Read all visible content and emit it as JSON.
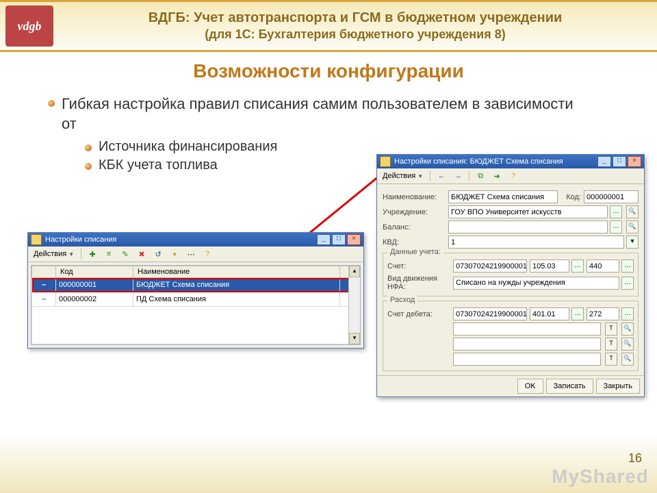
{
  "header": {
    "title1": "ВДГБ: Учет автотранспорта и ГСМ в бюджетном учреждении",
    "title2": "(для 1С: Бухгалтерия бюджетного учреждения 8)"
  },
  "section_title": "Возможности конфигурации",
  "bullets": {
    "main": "Гибкая настройка правил списания самим пользователем в зависимости от",
    "sub1": "Источника финансирования",
    "sub2": "КБК учета топлива"
  },
  "win1": {
    "title": "Настройки списания",
    "actions": "Действия",
    "cols": {
      "code": "Код",
      "name": "Наименование"
    },
    "rows": [
      {
        "code": "000000001",
        "name": "БЮДЖЕТ Схема списания"
      },
      {
        "code": "000000002",
        "name": "ПД Схема списания"
      }
    ]
  },
  "win2": {
    "title": "Настройки списания: БЮДЖЕТ Схема списания",
    "actions": "Действия",
    "labels": {
      "name": "Наименование:",
      "code": "Код:",
      "org": "Учреждение:",
      "balance": "Баланс:",
      "kvd": "КВД:",
      "account": "Счет:",
      "nfa": "Вид движения НФА:",
      "debit": "Счет дебета:"
    },
    "groups": {
      "account": "Данные учета:",
      "expense": "Расход"
    },
    "values": {
      "name": "БЮДЖЕТ Схема списания",
      "code": "000000001",
      "org": "ГОУ ВПО Университет искусств",
      "kvd": "1",
      "account_code": "07307024219900001",
      "account_num": "105.03",
      "account_sub": "440",
      "nfa": "Списано на нужды учреждения",
      "debit_code": "07307024219900001",
      "debit_num": "401.01",
      "debit_sub": "272"
    },
    "buttons": {
      "ok": "OK",
      "save": "Записать",
      "close": "Закрыть"
    }
  },
  "page_number": "16",
  "watermark": "MyShared"
}
